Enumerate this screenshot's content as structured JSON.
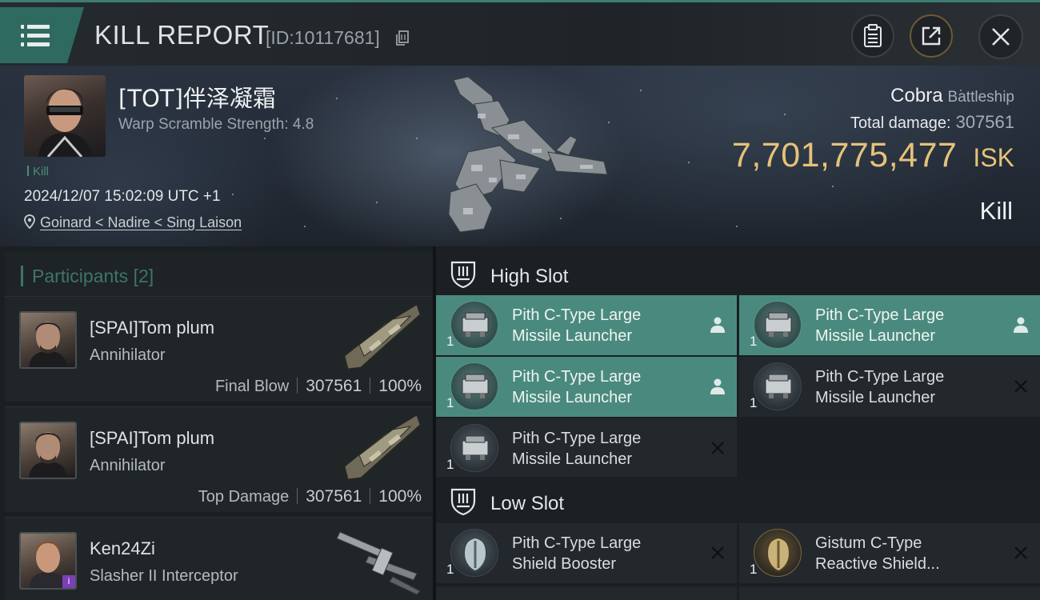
{
  "header": {
    "title": "KILL REPORT",
    "id_label": "[ID:10117681]"
  },
  "victim": {
    "name": "[TOT]伴泽凝霜",
    "warp_scramble": "Warp Scramble Strength: 4.8",
    "kill_tag": "Kill",
    "timestamp": "2024/12/07 15:02:09 UTC +1",
    "location": "Goinard < Nadire < Sing Laison",
    "ship_name": "Cobra",
    "ship_class": "Battleship",
    "total_damage_label": "Total damage:",
    "total_damage_value": "307561",
    "isk_value": "7,701,775,477",
    "isk_unit": "ISK",
    "result": "Kill"
  },
  "participants": {
    "label": "Participants",
    "count": "[2]",
    "items": [
      {
        "name": "[SPAI]Tom plum",
        "ship": "Annihilator",
        "role": "Final Blow",
        "damage": "307561",
        "percent": "100%"
      },
      {
        "name": "[SPAI]Tom plum",
        "ship": "Annihilator",
        "role": "Top Damage",
        "damage": "307561",
        "percent": "100%"
      },
      {
        "name": "Ken24Zi",
        "ship": "Slasher II Interceptor"
      }
    ]
  },
  "high_slot": {
    "title": "High Slot",
    "modules": [
      {
        "name_line1": "Pith C-Type Large",
        "name_line2": "Missile Launcher",
        "qty": "1",
        "status": "person-icon"
      },
      {
        "name_line1": "Pith C-Type Large",
        "name_line2": "Missile Launcher",
        "qty": "1",
        "status": "person-icon"
      },
      {
        "name_line1": "Pith C-Type Large",
        "name_line2": "Missile Launcher",
        "qty": "1",
        "status": "person-icon"
      },
      {
        "name_line1": "Pith C-Type Large",
        "name_line2": "Missile Launcher",
        "qty": "1",
        "status": "destroyed-x-icon"
      },
      {
        "name_line1": "Pith C-Type Large",
        "name_line2": "Missile Launcher",
        "qty": "1",
        "status": "destroyed-x-icon"
      }
    ]
  },
  "low_slot": {
    "title": "Low Slot",
    "modules": [
      {
        "name_line1": "Pith C-Type Large",
        "name_line2": "Shield Booster",
        "qty": "1",
        "status": "destroyed-x-icon"
      },
      {
        "name_line1": "Gistum C-Type",
        "name_line2": "Reactive Shield...",
        "qty": "1",
        "status": "destroyed-x-icon"
      }
    ]
  },
  "colors": {
    "accent_teal": "#4a8a7e",
    "isk_gold": "#e5c27a",
    "panel_dark": "#1b1f22"
  }
}
